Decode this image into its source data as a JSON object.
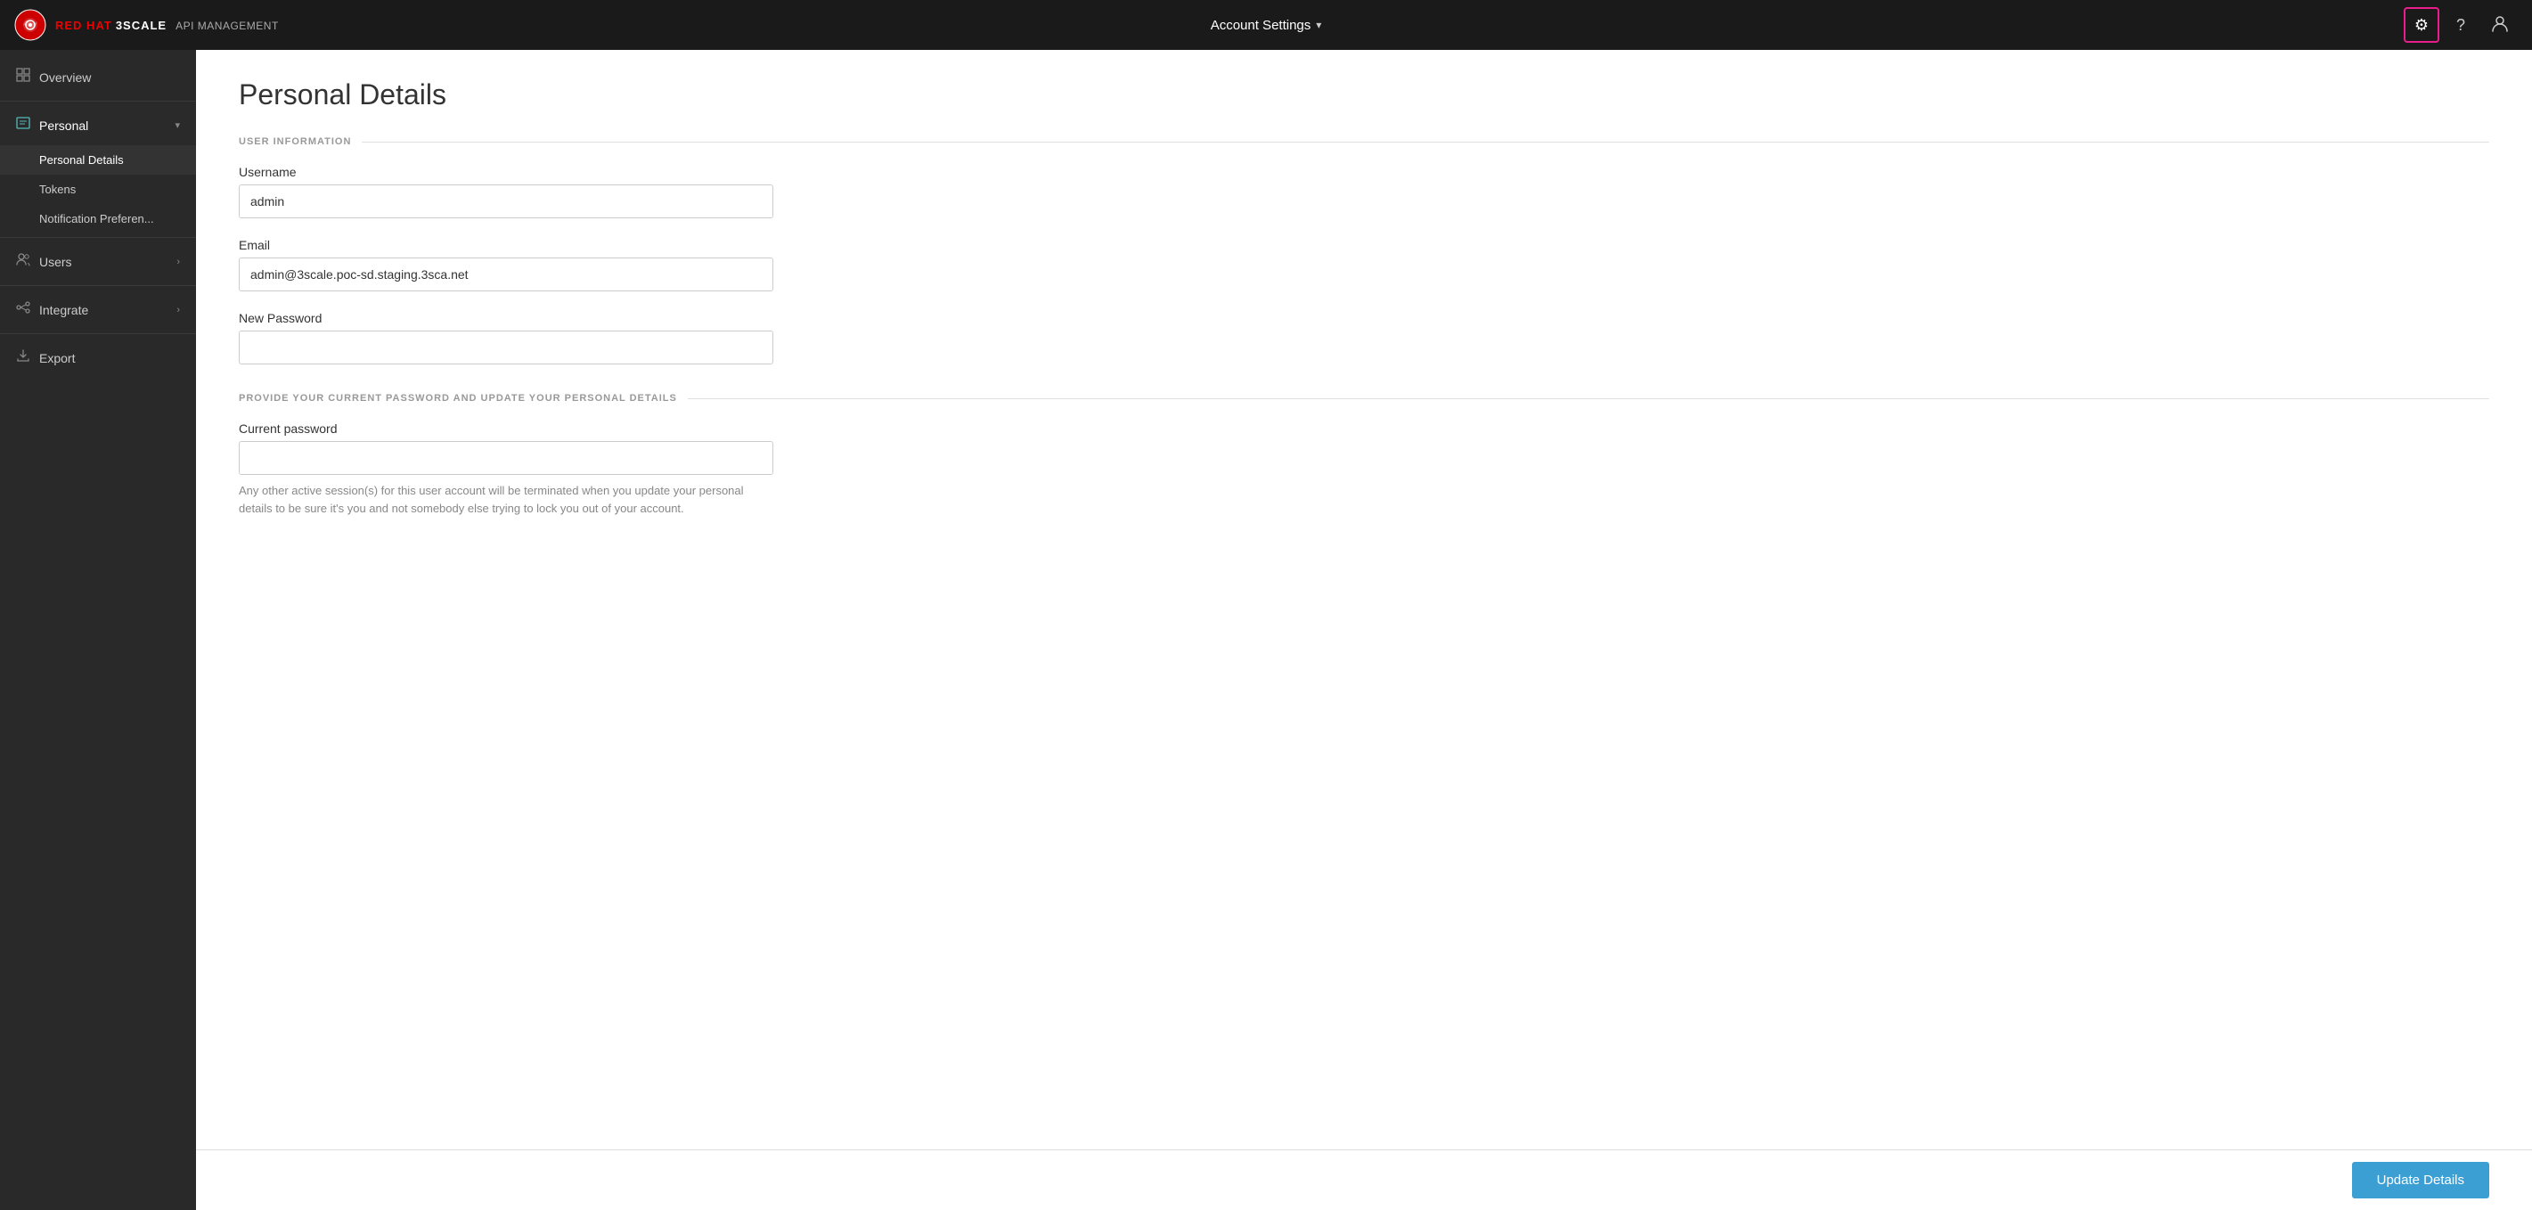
{
  "brand": {
    "redhat": "RED HAT",
    "threescale": "3SCALE",
    "api": "API MANAGEMENT"
  },
  "topnav": {
    "center_label": "Account Settings",
    "chevron": "▾",
    "gear_icon": "⚙",
    "help_icon": "?",
    "user_icon": "👤"
  },
  "sidebar": {
    "overview_label": "Overview",
    "personal_label": "Personal",
    "personal_details_label": "Personal Details",
    "tokens_label": "Tokens",
    "notification_label": "Notification Preferen...",
    "users_label": "Users",
    "integrate_label": "Integrate",
    "export_label": "Export"
  },
  "page": {
    "title": "Personal Details",
    "section1_label": "USER INFORMATION",
    "username_label": "Username",
    "username_value": "admin",
    "email_label": "Email",
    "email_value": "admin@3scale.poc-sd.staging.3sca.net",
    "new_password_label": "New Password",
    "new_password_value": "",
    "section2_label": "PROVIDE YOUR CURRENT PASSWORD AND UPDATE YOUR PERSONAL DETAILS",
    "current_password_label": "Current password",
    "current_password_value": "",
    "help_text": "Any other active session(s) for this user account will be terminated when you update your personal details to be sure it's you and not somebody else trying to lock you out of your account.",
    "update_button_label": "Update Details"
  }
}
